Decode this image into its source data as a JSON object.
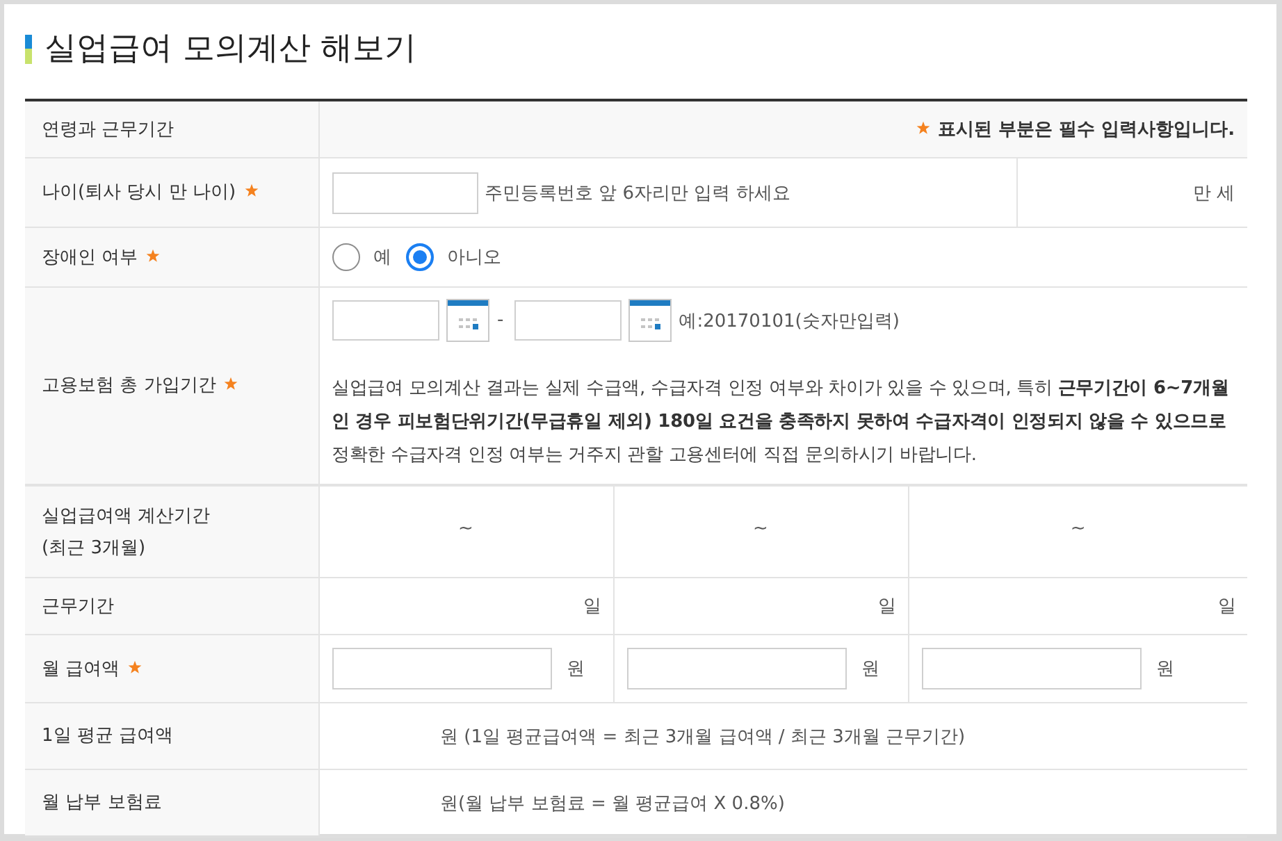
{
  "title": "실업급여 모의계산 해보기",
  "form": {
    "section": {
      "label": "연령과 근무기간",
      "required_note": "표시된 부분은 필수 입력사항입니다."
    },
    "rows": [
      {
        "kind": "age",
        "label": "나이(퇴사 당시 만 나이)",
        "required": true,
        "hint": "주민등록번호 앞 6자리만 입력 하세요",
        "unit": "만 세"
      },
      {
        "kind": "radio",
        "label": "장애인 여부",
        "required": true,
        "options": [
          {
            "label": "예",
            "selected": false
          },
          {
            "label": "아니오",
            "selected": true
          }
        ]
      },
      {
        "kind": "period",
        "label": "고용보험 총 가입기간",
        "required": true,
        "separator": "-",
        "example": "예:20170101(숫자만입력)",
        "notice": "실업급여 모의계산 결과는 실제 수급액, 수급자격 인정 여부와 차이가 있을 수 있으며, 특히 **근무기간이 6~7개월인 경우 피보험단위기간(무급휴일 제외) 180일 요건을 충족하지 못하여 수급자격이 인정되지 않을 수 있으므로** 정확한 수급자격 인정 여부는 거주지 관할 고용센터에 직접 문의하시기 바랍니다."
      },
      {
        "kind": "ranges",
        "label": "실업급여액 계산기간\n(최근 3개월)",
        "required": false,
        "cells": [
          "~",
          "~",
          "~"
        ]
      },
      {
        "kind": "days",
        "label": "근무기간",
        "required": false,
        "cells": [
          "일",
          "일",
          "일"
        ]
      },
      {
        "kind": "amounts",
        "label": "월 급여액",
        "required": true,
        "cells": [
          "원",
          "원",
          "원"
        ]
      },
      {
        "kind": "formula",
        "label": "1일 평균 급여액",
        "required": false,
        "text": "원 (1일 평균급여액 = 최근 3개월 급여액 / 최근 3개월 근무기간)"
      },
      {
        "kind": "formula",
        "label": "월 납부 보험료",
        "required": false,
        "text": "원(월 납부 보험료 = 월 평균급여 X 0.8%)"
      }
    ]
  }
}
